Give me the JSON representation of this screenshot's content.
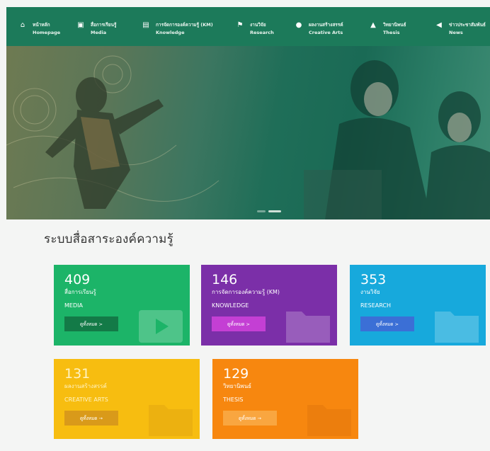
{
  "nav": {
    "items": [
      {
        "icon": "home-icon",
        "glyph": "⌂",
        "th": "หน้าหลัก",
        "en": "Homepage"
      },
      {
        "icon": "media-icon",
        "glyph": "▣",
        "th": "สื่อการเรียนรู้",
        "en": "Media"
      },
      {
        "icon": "book-icon",
        "glyph": "▤",
        "th": "การจัดการองค์ความรู้ (KM)",
        "en": "Knowledge"
      },
      {
        "icon": "flag-icon",
        "glyph": "⚑",
        "th": "งานวิจัย",
        "en": "Research"
      },
      {
        "icon": "pin-icon",
        "glyph": "●",
        "th": "ผลงานสร้างสรรค์",
        "en": "Creative Arts"
      },
      {
        "icon": "graduation-cap-icon",
        "glyph": "▲",
        "th": "วิทยานิพนธ์",
        "en": "Thesis"
      },
      {
        "icon": "megaphone-icon",
        "glyph": "◀",
        "th": "ข่าวประชาสัมพันธ์",
        "en": "News"
      }
    ]
  },
  "section_title": "ระบบสื่อสาระองค์ความรู้",
  "cards": [
    {
      "count": "409",
      "th": "สื่อการเรียนรู้",
      "en": "MEDIA",
      "button": "ดูทั้งหมด >",
      "color": "#1cb468",
      "button_color": "#137a47",
      "text_color": "#ffffff"
    },
    {
      "count": "146",
      "th": "การจัดการองค์ความรู้ (KM)",
      "en": "KNOWLEDGE",
      "button": "ดูทั้งหมด >",
      "color": "#7b2fa8",
      "button_color": "#c43fd4",
      "text_color": "#ffffff"
    },
    {
      "count": "353",
      "th": "งานวิจัย",
      "en": "RESEARCH",
      "button": "ดูทั้งหมด >",
      "color": "#17a9dc",
      "button_color": "#3b6fd6",
      "text_color": "#ffffff"
    },
    {
      "count": "131",
      "th": "ผลงานสร้างสรรค์",
      "en": "CREATIVE ARTS",
      "button": "ดูทั้งหมด →",
      "color": "#f7bd10",
      "button_color": "#d99a1a",
      "text_color": "#fff3c4"
    },
    {
      "count": "129",
      "th": "วิทยานิพนธ์",
      "en": "THESIS",
      "button": "ดูทั้งหมด →",
      "color": "#f7870f",
      "button_color": "#f9a640",
      "text_color": "#ffffff"
    }
  ]
}
